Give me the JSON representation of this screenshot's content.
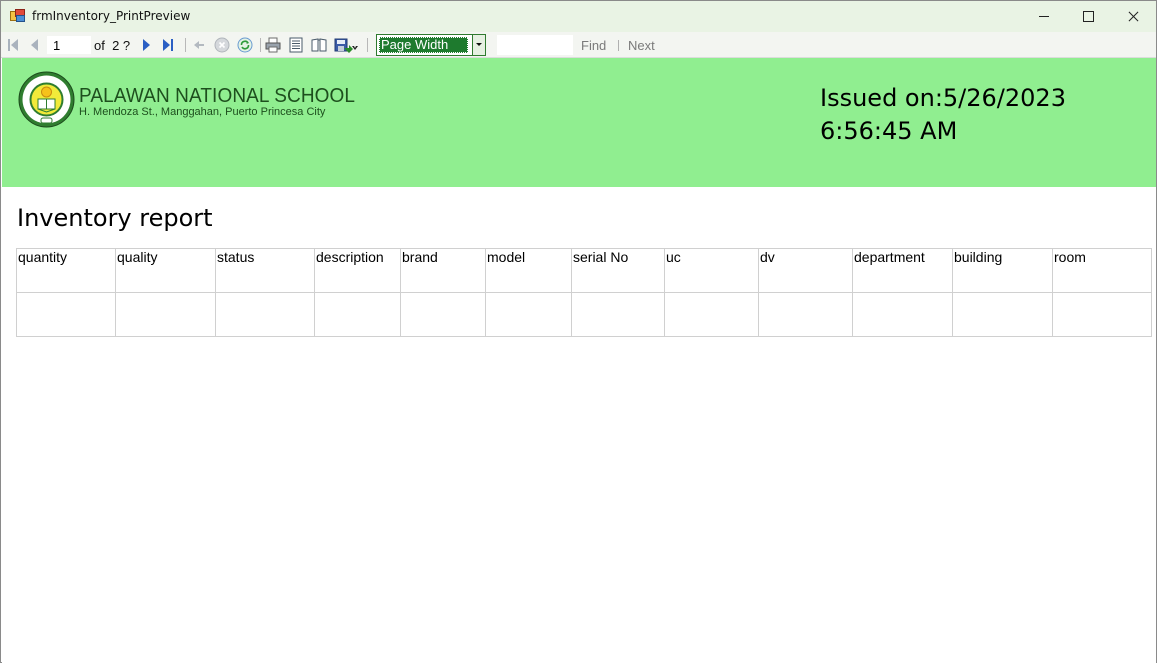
{
  "window": {
    "title": "frmInventory_PrintPreview",
    "controls": {
      "minimize": "minimize",
      "maximize": "maximize",
      "close": "close"
    }
  },
  "toolbar": {
    "current_page": "1",
    "of_label": "of",
    "total_pages": "2 ?",
    "zoom_value": "Page Width",
    "find_value": "",
    "find_label": "Find",
    "next_label": "Next",
    "icons": [
      "first-page-icon",
      "previous-page-icon",
      "next-page-icon",
      "last-page-icon",
      "back-icon",
      "stop-icon",
      "refresh-icon",
      "print-icon",
      "print-layout-icon",
      "page-setup-icon",
      "export-icon"
    ]
  },
  "report": {
    "colors": {
      "header_band": "#90ee90",
      "school_text": "#1d4f1d"
    },
    "school_name": "PALAWAN NATIONAL SCHOOL",
    "school_address": "H. Mendoza St., Manggahan, Puerto Princesa City",
    "issued_line1": "Issued on:5/26/2023",
    "issued_line2": "6:56:45 AM",
    "title": "Inventory report",
    "columns": [
      "quantity",
      "quality",
      "status",
      "description",
      "brand",
      "model",
      "serial No",
      "uc",
      "dv",
      "department",
      "building",
      "room"
    ],
    "rows": [
      [
        "",
        "",
        "",
        "",
        "",
        "",
        "",
        "",
        "",
        "",
        "",
        ""
      ]
    ]
  }
}
